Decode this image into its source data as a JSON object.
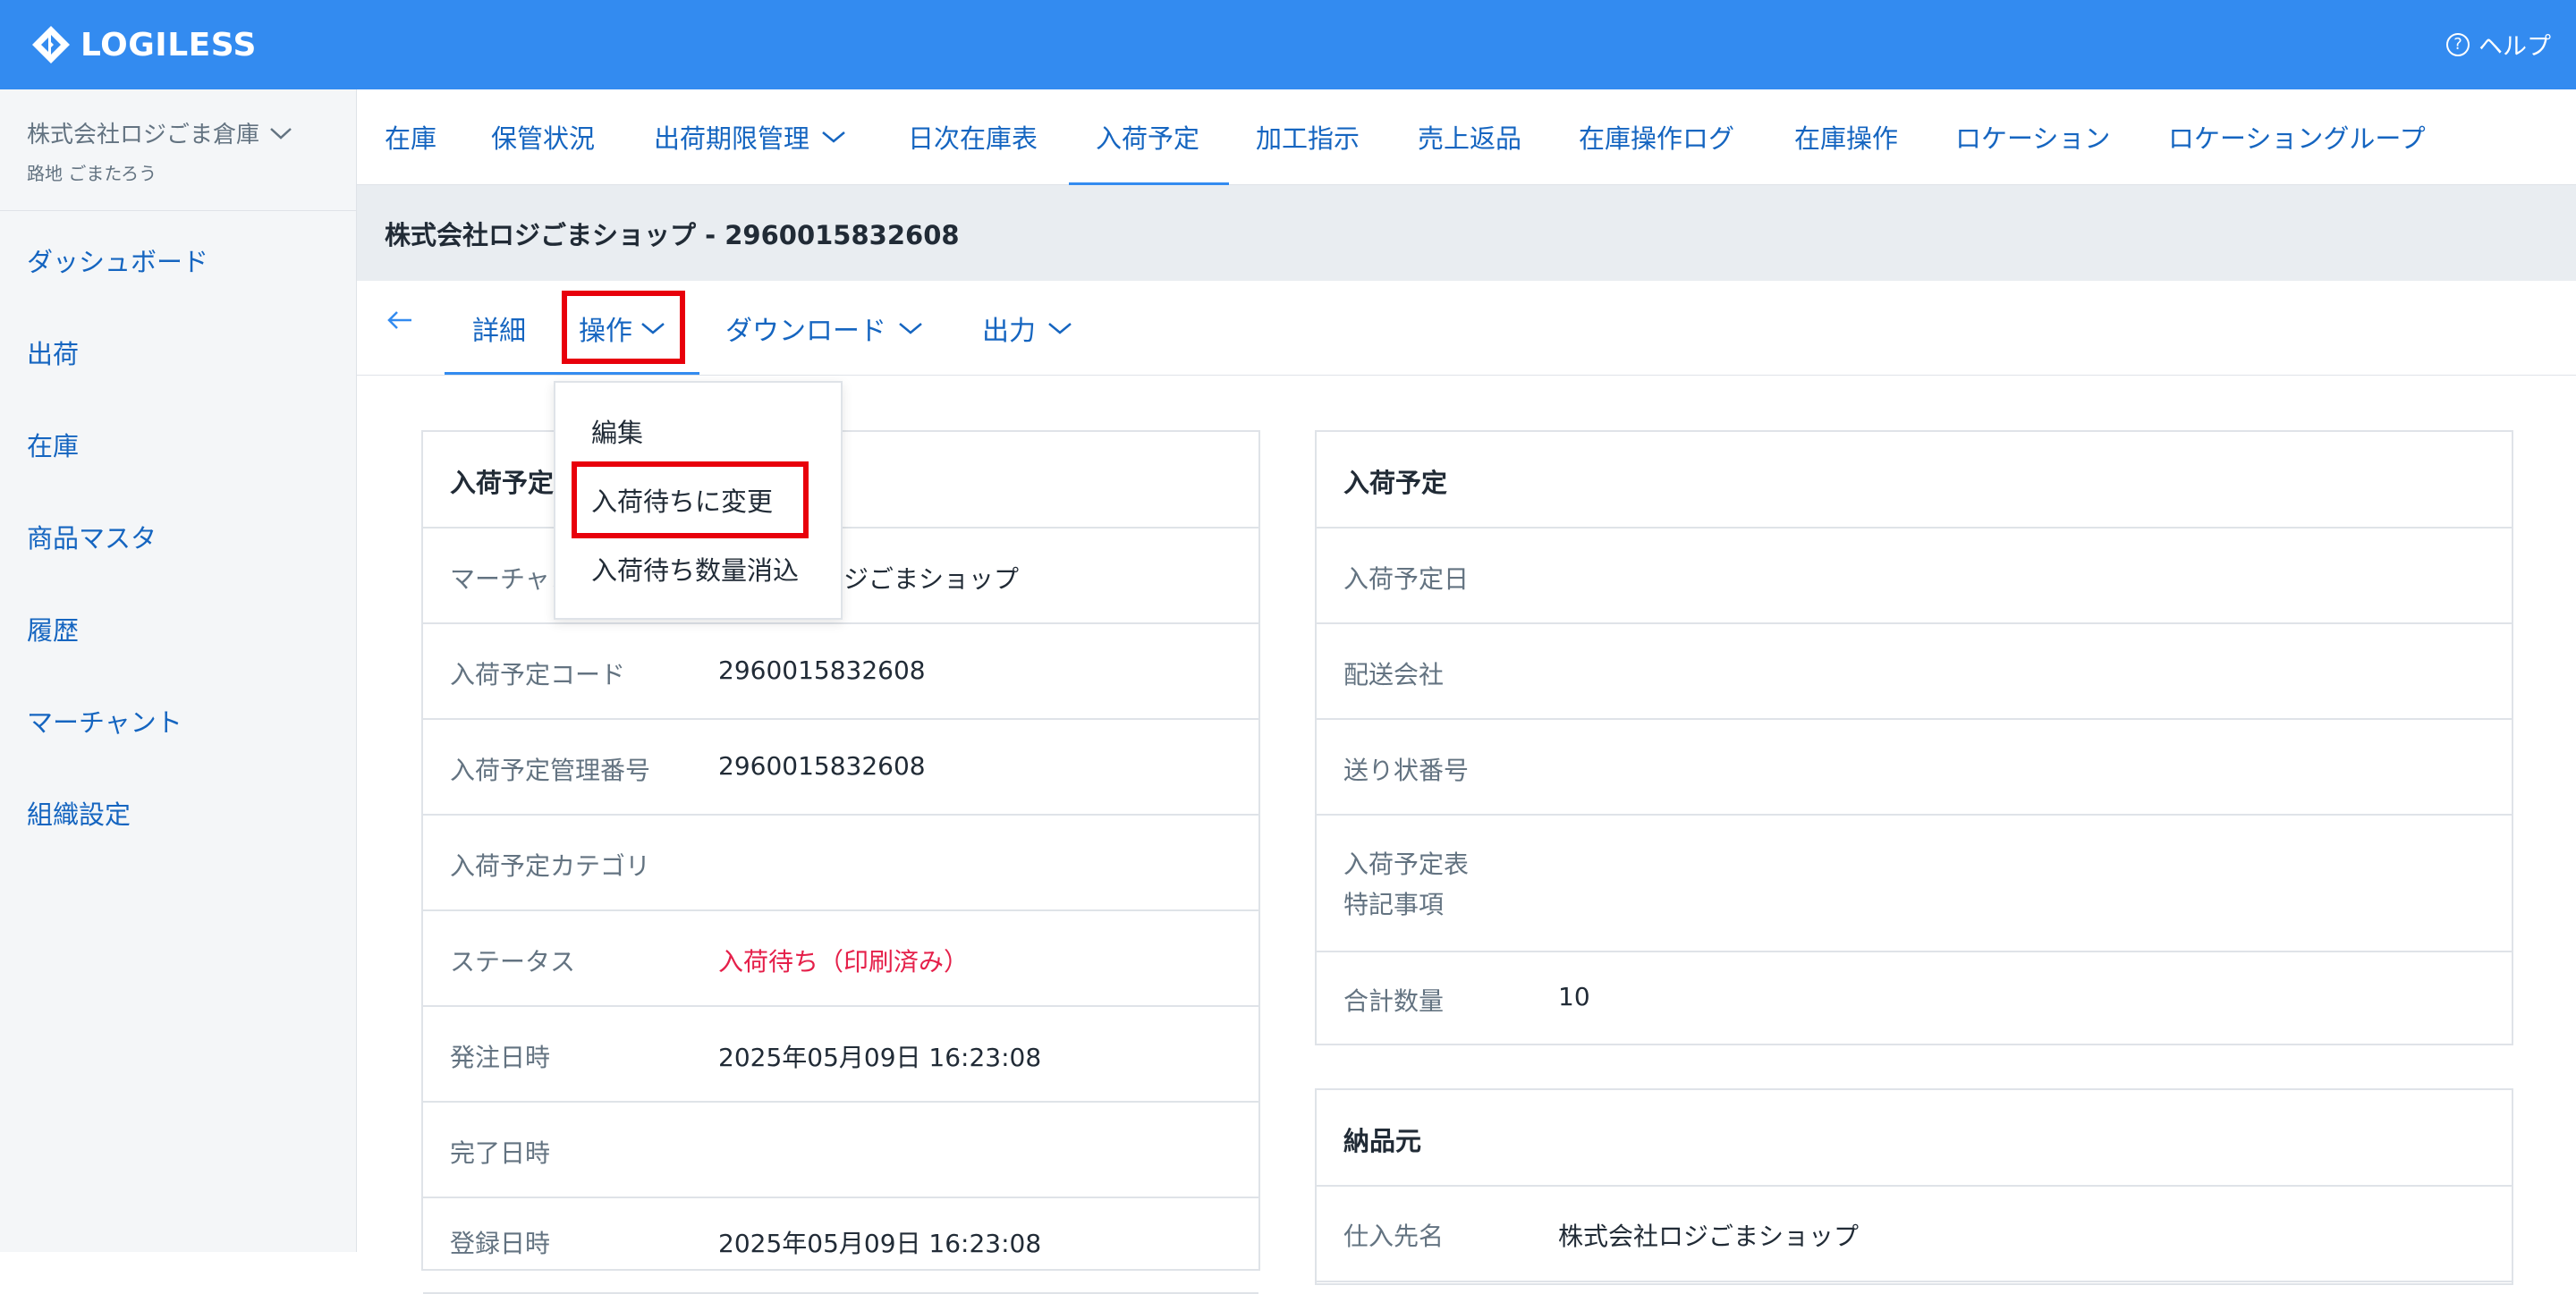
{
  "header": {
    "logo_text": "LOGILESS",
    "help_label": "ヘルプ"
  },
  "sidebar": {
    "org_name": "株式会社ロジごま倉庫",
    "user_name": "路地 ごまたろう",
    "items": [
      "ダッシュボード",
      "出荷",
      "在庫",
      "商品マスタ",
      "履歴",
      "マーチャント",
      "組織設定"
    ]
  },
  "top_tabs": [
    "在庫",
    "保管状況",
    "出荷期限管理",
    "日次在庫表",
    "入荷予定",
    "加工指示",
    "売上返品",
    "在庫操作ログ",
    "在庫操作",
    "ロケーション",
    "ロケーショングループ"
  ],
  "active_tab": "入荷予定",
  "page_title": "株式会社ロジごまショップ - 2960015832608",
  "subnav": {
    "detail": "詳細",
    "operation": "操作",
    "download": "ダウンロード",
    "output": "出力"
  },
  "dropdown": {
    "items": [
      "編集",
      "入荷待ちに変更",
      "入荷待ち数量消込"
    ]
  },
  "left_card": {
    "title": "入荷予定",
    "rows": [
      {
        "label": "マーチャント",
        "value": "株式会社ロジごまショップ"
      },
      {
        "label": "入荷予定コード",
        "value": "2960015832608"
      },
      {
        "label": "入荷予定管理番号",
        "value": "2960015832608"
      },
      {
        "label": "入荷予定カテゴリ",
        "value": ""
      },
      {
        "label": "ステータス",
        "value": "入荷待ち（印刷済み）"
      },
      {
        "label": "発注日時",
        "value": "2025年05月09日 16:23:08"
      },
      {
        "label": "完了日時",
        "value": ""
      },
      {
        "label": "登録日時",
        "value": "2025年05月09日 16:23:08"
      }
    ]
  },
  "right_card": {
    "title": "入荷予定",
    "rows": [
      {
        "label": "入荷予定日",
        "value": ""
      },
      {
        "label": "配送会社",
        "value": ""
      },
      {
        "label": "送り状番号",
        "value": ""
      },
      {
        "label": "入荷予定表\n特記事項",
        "value": ""
      },
      {
        "label": "合計数量",
        "value": "10"
      }
    ]
  },
  "supplier_card": {
    "title": "納品元",
    "rows": [
      {
        "label": "仕入先名",
        "value": "株式会社ロジごまショップ"
      }
    ]
  },
  "colors": {
    "header_bg": "#338bf0",
    "link": "#1565c0",
    "status_red": "#e5204a",
    "highlight": "#e8000b"
  },
  "icons": [
    "logo-diamond-icon",
    "help-circle-icon",
    "chevron-down-icon",
    "back-arrow-icon"
  ]
}
